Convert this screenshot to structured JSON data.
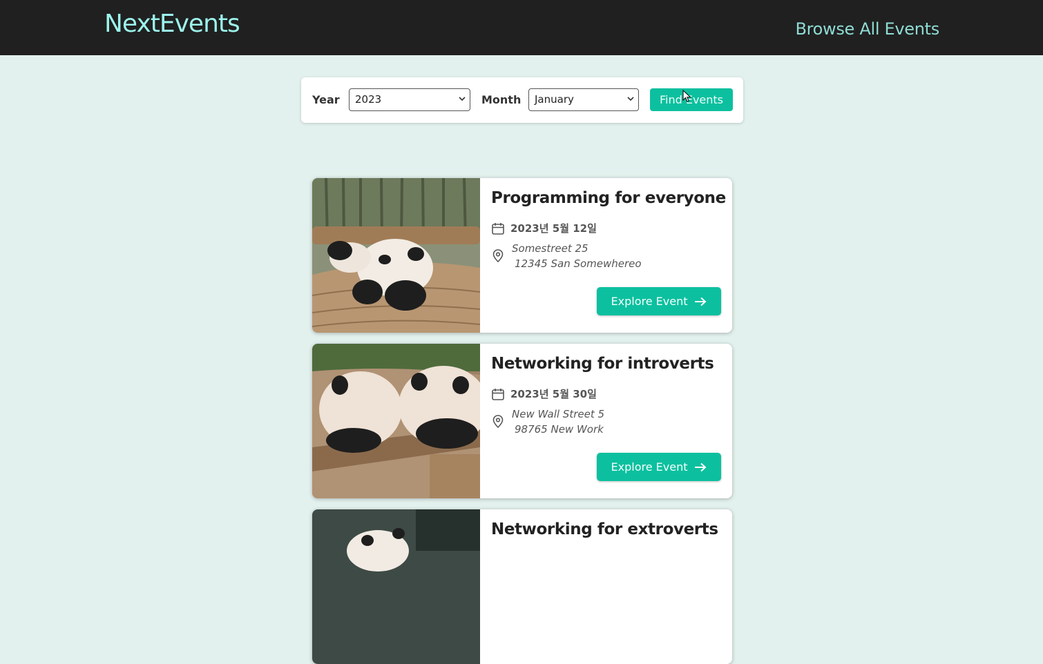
{
  "header": {
    "logo": "NextEvents",
    "nav_link": "Browse All Events"
  },
  "filter": {
    "year_label": "Year",
    "year_value": "2023",
    "month_label": "Month",
    "month_value": "January",
    "find_button": "Find Events"
  },
  "events": [
    {
      "title": "Programming for everyone",
      "date": "2023년 5월 12일",
      "address_line1": "Somestreet 25",
      "address_line2": "12345 San Somewhereo",
      "button": "Explore Event"
    },
    {
      "title": "Networking for introverts",
      "date": "2023년 5월 30일",
      "address_line1": "New Wall Street 5",
      "address_line2": "98765 New Work",
      "button": "Explore Event"
    },
    {
      "title": "Networking for extroverts"
    }
  ],
  "colors": {
    "accent": "#0cc09f",
    "header_bg": "#202020",
    "logo": "#9cf4ec",
    "page_bg": "#e3f1ee"
  },
  "icons": {
    "date": "calendar-icon",
    "address": "map-pin-icon",
    "button": "arrow-right-icon",
    "select": "chevron-down-icon"
  }
}
